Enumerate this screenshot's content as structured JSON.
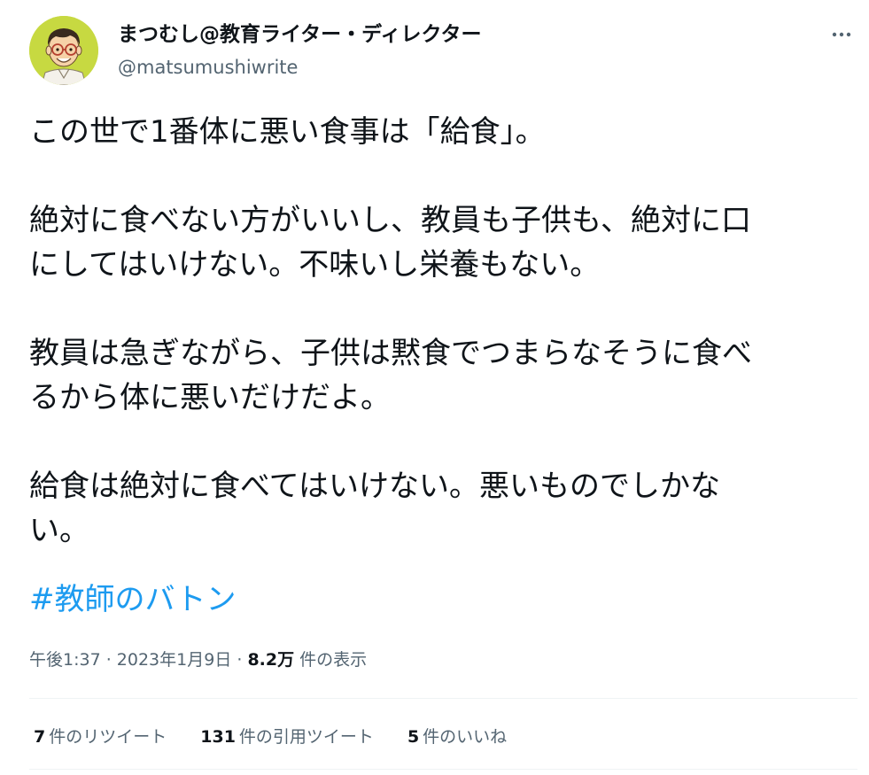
{
  "author": {
    "display_name": "まつむし@教育ライター・ディレクター",
    "handle": "@matsumushiwrite",
    "avatar_icon": "cartoon-avatar-icon"
  },
  "more_icon": "more-horizontal-icon",
  "tweet": {
    "paragraphs": [
      [
        "この世で1番体に悪い食事は「給食」。"
      ],
      [
        "絶対に食べない方がいいし、教員も子供も、絶対に口",
        "にしてはいけない。不味いし栄養もない。"
      ],
      [
        "教員は急ぎながら、子供は黙食でつまらなそうに食べ",
        "るから体に悪いだけだよ。"
      ],
      [
        "給食は絶対に食べてはいけない。悪いものでしかな",
        "い。"
      ]
    ],
    "hashtag": "#教師のバトン"
  },
  "meta": {
    "time": "午後1:37",
    "sep1": " · ",
    "date": "2023年1月9日",
    "sep2": " · ",
    "views_count": "8.2万",
    "views_label": " 件の表示"
  },
  "stats": {
    "retweets_count": "7",
    "retweets_label": "件のリツイート",
    "quotes_count": "131",
    "quotes_label": "件の引用ツイート",
    "likes_count": "5",
    "likes_label": "件のいいね"
  },
  "colors": {
    "text": "#0f1419",
    "secondary": "#536471",
    "link": "#1d9bf0",
    "divider": "#eff3f4",
    "avatar_bg": "#c7d941"
  }
}
